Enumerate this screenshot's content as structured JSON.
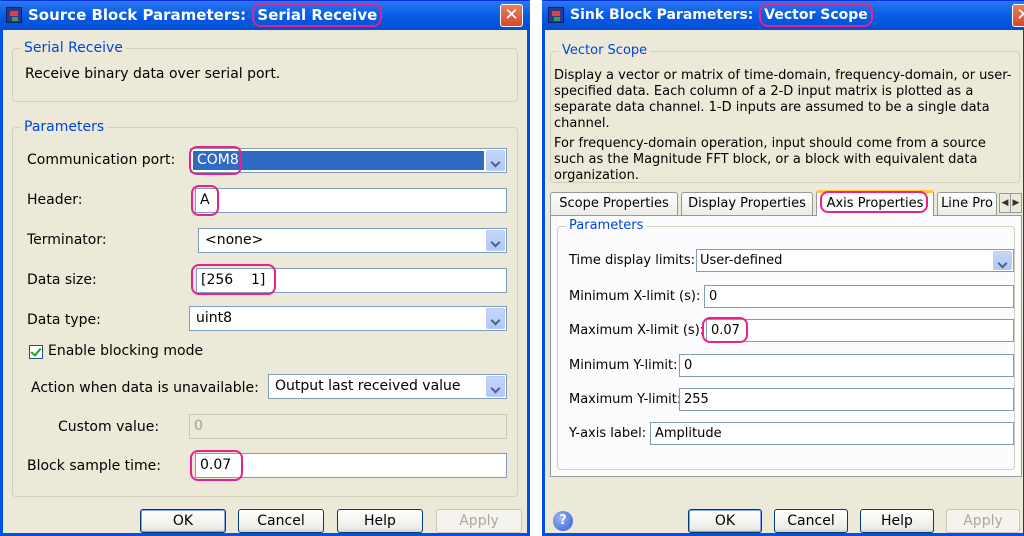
{
  "left_dialog": {
    "title_prefix": "Source Block Parameters:",
    "title_block": "Serial Receive",
    "close": "✕",
    "description_group": "Serial Receive",
    "description": "Receive binary data over serial port.",
    "params_group": "Parameters",
    "comm_port_label": "Communication port:",
    "comm_port_value": "COM8",
    "header_label": "Header:",
    "header_value": "A",
    "terminator_label": "Terminator:",
    "terminator_value": "<none>",
    "data_size_label": "Data size:",
    "data_size_value": "[256    1]",
    "data_type_label": "Data type:",
    "data_type_value": "uint8",
    "blocking_label": "Enable blocking mode",
    "blocking_checked": true,
    "action_label": "Action when data is unavailable:",
    "action_value": "Output last received value",
    "custom_label": "Custom value:",
    "custom_value": "0",
    "sample_time_label": "Block sample time:",
    "sample_time_value": "0.07",
    "buttons": {
      "ok": "OK",
      "cancel": "Cancel",
      "help": "Help",
      "apply": "Apply"
    }
  },
  "right_dialog": {
    "title_prefix": "Sink Block Parameters:",
    "title_block": "Vector Scope",
    "close": "✕",
    "description_group": "Vector Scope",
    "description_1": "Display a vector or matrix of time-domain, frequency-domain, or user-specified data.  Each column of a 2-D input matrix is plotted as a separate data channel.  1-D inputs are assumed to be a single data channel.",
    "description_2": "For frequency-domain operation, input should come from a source such as the Magnitude FFT block, or a block with equivalent data organization.",
    "tabs": [
      "Scope Properties",
      "Display Properties",
      "Axis Properties",
      "Line Pro"
    ],
    "active_tab": 2,
    "params_group": "Parameters",
    "time_limits_label": "Time display limits:",
    "time_limits_value": "User-defined",
    "min_x_label": "Minimum X-limit (s):",
    "min_x_value": "0",
    "max_x_label": "Maximum X-limit (s):",
    "max_x_value": "0.07",
    "min_y_label": "Minimum Y-limit:",
    "min_y_value": "0",
    "max_y_label": "Maximum Y-limit:",
    "max_y_value": "255",
    "ylabel_label": "Y-axis label:",
    "ylabel_value": "Amplitude",
    "help_icon_glyph": "?",
    "buttons": {
      "ok": "OK",
      "cancel": "Cancel",
      "help": "Help",
      "apply": "Apply"
    }
  },
  "colors": {
    "titlebar": "#0a5ee6",
    "highlight": "#e6238c",
    "group_label": "#0046d5",
    "dialog_bg": "#ece9d8"
  }
}
